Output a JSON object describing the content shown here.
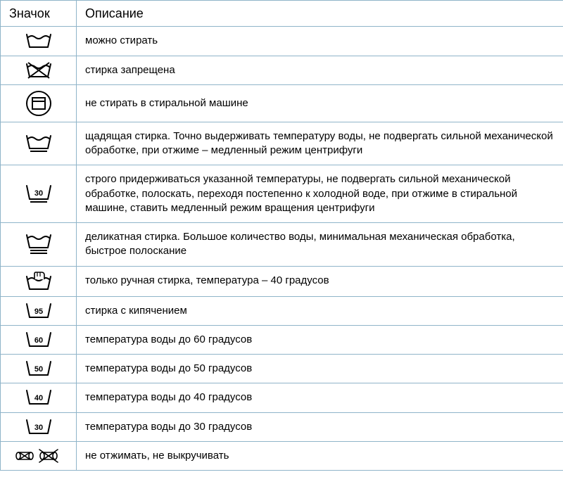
{
  "headers": {
    "icon": "Значок",
    "description": "Описание"
  },
  "rows": [
    {
      "icon_name": "wash-allowed-icon",
      "description": "можно стирать"
    },
    {
      "icon_name": "wash-forbidden-icon",
      "description": "стирка запрещена"
    },
    {
      "icon_name": "no-machine-wash-icon",
      "description": "не стирать в стиральной машине"
    },
    {
      "icon_name": "gentle-wash-icon",
      "description": "щадящая стирка. Точно выдерживать температуру воды, не подвергать сильной механической обработке, при отжиме – медленный режим центрифуги"
    },
    {
      "icon_name": "wash-30-gentle-icon",
      "description": "строго придерживаться указанной температуры, не подвергать сильной механической обработке, полоскать, переходя постепенно к холодной воде, при отжиме в стиральной машине, ставить медленный режим вращения центрифуги"
    },
    {
      "icon_name": "delicate-wash-icon",
      "description": "деликатная стирка. Большое количество воды, минимальная механическая обработка, быстрое полоскание"
    },
    {
      "icon_name": "hand-wash-icon",
      "description": "только ручная стирка, температура – 40 градусов"
    },
    {
      "icon_name": "wash-95-icon",
      "description": "стирка с кипячением"
    },
    {
      "icon_name": "wash-60-icon",
      "description": "температура воды до 60 градусов"
    },
    {
      "icon_name": "wash-50-icon",
      "description": "температура воды до 50 градусов"
    },
    {
      "icon_name": "wash-40-icon",
      "description": "температура воды до 40 градусов"
    },
    {
      "icon_name": "wash-30-icon",
      "description": "температура воды до 30 градусов"
    },
    {
      "icon_name": "no-wring-icon",
      "description": "не отжимать, не выкручивать"
    }
  ]
}
